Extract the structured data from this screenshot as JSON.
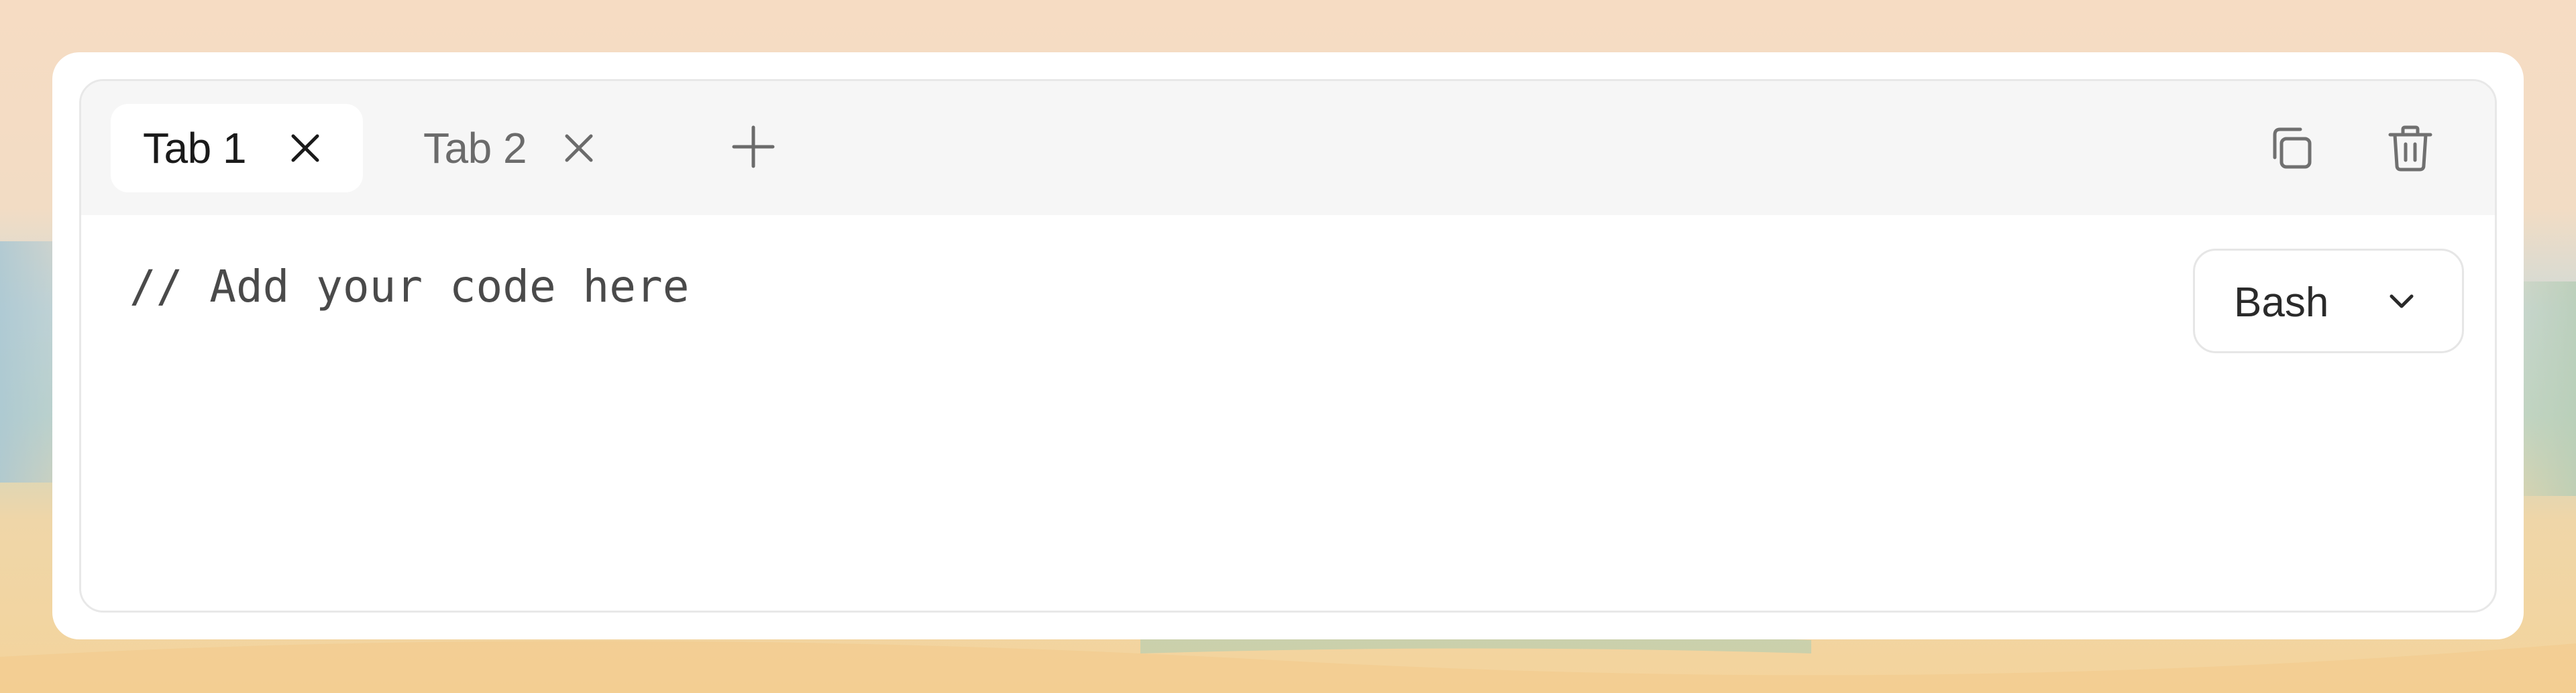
{
  "tabs": [
    {
      "label": "Tab 1",
      "active": true
    },
    {
      "label": "Tab 2",
      "active": false
    }
  ],
  "toolbar": {
    "add_tab_icon": "plus-icon",
    "copy_icon": "copy-icon",
    "delete_icon": "trash-icon"
  },
  "editor": {
    "placeholder_line": "// Add your code here"
  },
  "language_select": {
    "value": "Bash",
    "icon": "chevron-down-icon"
  },
  "colors": {
    "tab_bar_bg": "#f6f6f6",
    "active_tab_bg": "#ffffff",
    "active_tab_text": "#1a1a1a",
    "inactive_tab_text": "#6b6b6b",
    "code_text": "#4a4a4a"
  }
}
